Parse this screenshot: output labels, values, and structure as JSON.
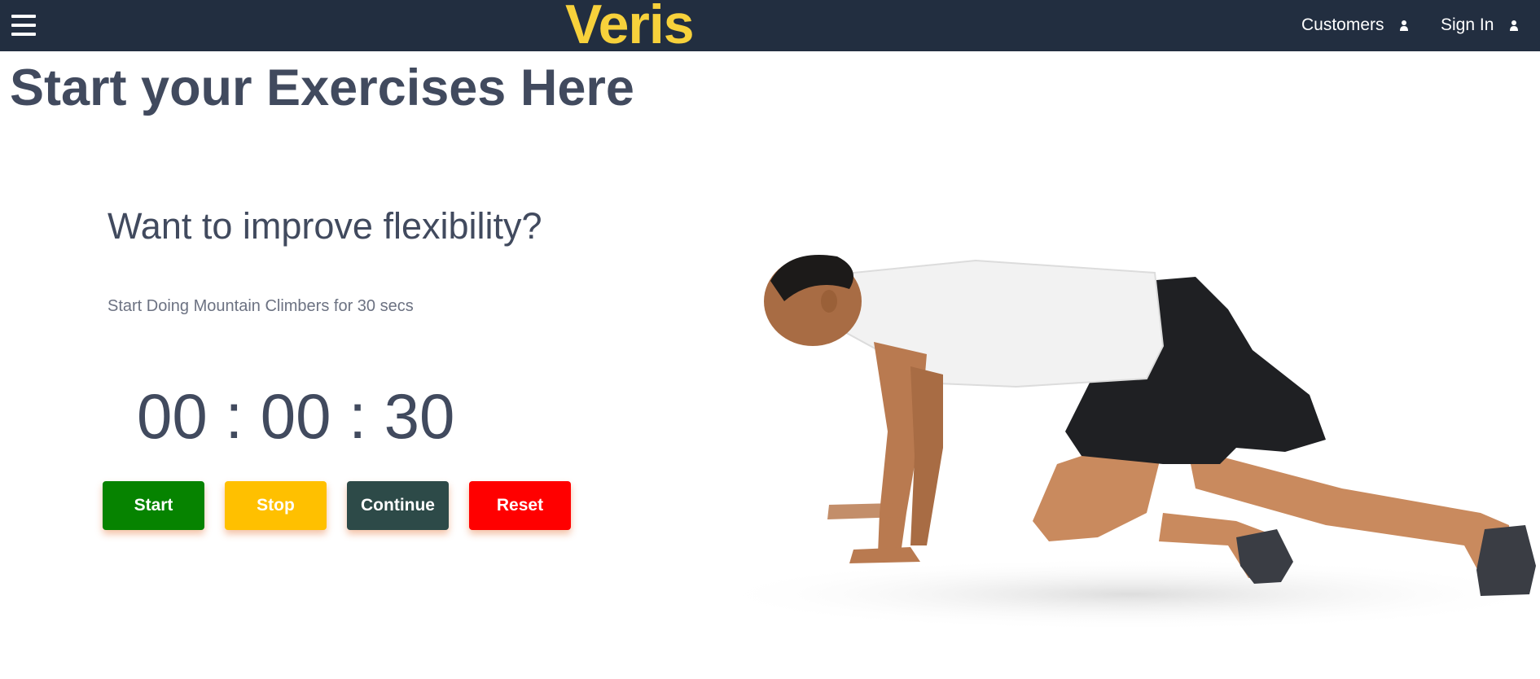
{
  "navbar": {
    "brand": "Veris",
    "menu_icon": "hamburger-menu-icon",
    "links": [
      {
        "label": "Customers",
        "icon": "user-icon"
      },
      {
        "label": "Sign In",
        "icon": "user-icon"
      }
    ],
    "colors": {
      "background": "#222e40",
      "brand": "#f7d13b",
      "link": "#ffffff"
    }
  },
  "main": {
    "title": "Start your Exercises Here",
    "question": "Want to improve flexibility?",
    "instruction": "Start Doing Mountain Climbers for 30 secs",
    "timer": {
      "hours": "00",
      "separator1": ":",
      "minutes": "00",
      "separator2": ":",
      "seconds": "30"
    },
    "buttons": {
      "start": "Start",
      "stop": "Stop",
      "continue": "Continue",
      "reset": "Reset"
    },
    "button_colors": {
      "start": "#068300",
      "stop": "#ffc000",
      "continue": "#2d4a48",
      "reset": "#ff0000"
    },
    "image": {
      "depicts": "man performing mountain climber exercise"
    }
  }
}
